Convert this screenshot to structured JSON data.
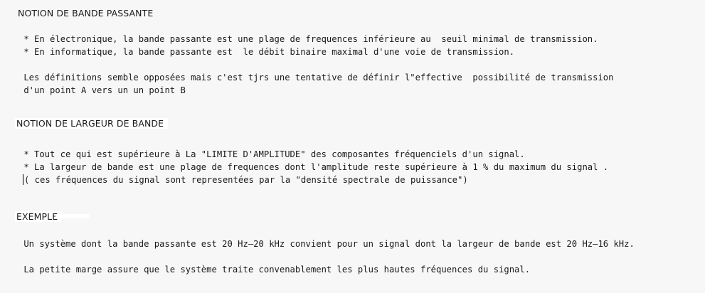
{
  "section1": {
    "title": "NOTION DE BANDE PASSANTE",
    "bullet1": " * En électronique, la bande passante est une plage de frequences inférieure au  seuil minimal de transmission.",
    "bullet2": " * En informatique, la bande passante est  le débit binaire maximal d'une voie de transmission.",
    "para_line1": " Les définitions semble opposées mais c'est tjrs une tentative de définir l\"effective  possibilité de transmission",
    "para_line2": " d'un point A vers un un point B"
  },
  "section2": {
    "title": "NOTION DE LARGEUR DE BANDE",
    "bullet1": " * Tout ce qui est supérieure à La \"LIMITE D'AMPLITUDE\" des composantes fréquenciels d'un signal.",
    "bullet2": " * La largeur de bande est une plage de frequences dont l'amplitude reste supérieure à 1 % du maximum du signal .",
    "note": "( ces fréquences du signal sont representées par la \"densité spectrale de puissance\")"
  },
  "section3": {
    "title": "EXEMPLE",
    "para1": " Un système dont la bande passante est 20 Hz–20 kHz convient pour un signal dont la largeur de bande est 20 Hz–16 kHz.",
    "para2": " La petite marge assure que le système traite convenablement les plus hautes fréquences du signal."
  }
}
